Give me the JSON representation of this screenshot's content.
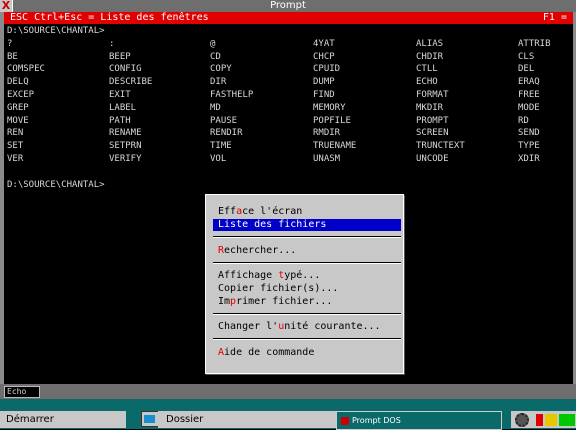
{
  "window": {
    "title": "Prompt",
    "close_glyph": "X"
  },
  "hotbar": {
    "left": "ESC   Ctrl+Esc = Liste des fenêtres",
    "right": "F1 ="
  },
  "terminal": {
    "prompt1": "D:\\SOURCE\\CHANTAL>",
    "commands": [
      [
        "?",
        ":",
        "@",
        "4YAT",
        "ALIAS",
        "ATTRIB"
      ],
      [
        "BE",
        "BEEP",
        "CD",
        "CHCP",
        "CHDIR",
        "CLS"
      ],
      [
        "COMSPEC",
        "CONFIG",
        "COPY",
        "CPUID",
        "CTLL",
        "DEL"
      ],
      [
        "DELQ",
        "DESCRIBE",
        "DIR",
        "DUMP",
        "ECHO",
        "ERAQ"
      ],
      [
        "EXCEP",
        "EXIT",
        "FASTHELP",
        "FIND",
        "FORMAT",
        "FREE"
      ],
      [
        "GREP",
        "LABEL",
        "MD",
        "MEMORY",
        "MKDIR",
        "MODE"
      ],
      [
        "MOVE",
        "PATH",
        "PAUSE",
        "POPFILE",
        "PROMPT",
        "RD"
      ],
      [
        "REN",
        "RENAME",
        "RENDIR",
        "RMDIR",
        "SCREEN",
        "SEND"
      ],
      [
        "SET",
        "SETPRN",
        "TIME",
        "TRUENAME",
        "TRUNCTEXT",
        "TYPE"
      ],
      [
        "VER",
        "VERIFY",
        "VOL",
        "UNASM",
        "UNCODE",
        "XDIR"
      ]
    ],
    "prompt2": "D:\\SOURCE\\CHANTAL>"
  },
  "context_menu": {
    "items": [
      {
        "pre": "Eff",
        "hk": "a",
        "post": "ce l'écran"
      },
      {
        "pre": "",
        "hk": "L",
        "post": "iste des fichiers"
      },
      {
        "pre": "",
        "hk": "R",
        "post": "echercher..."
      },
      {
        "pre": "Affichage ",
        "hk": "t",
        "post": "ypé..."
      },
      {
        "pre": "Copier fichier(s)",
        "hk": "",
        "post": "..."
      },
      {
        "pre": "Im",
        "hk": "p",
        "post": "rimer fichier..."
      },
      {
        "pre": "Changer l'",
        "hk": "u",
        "post": "nité courante..."
      },
      {
        "pre": "",
        "hk": "A",
        "post": "ide de commande"
      }
    ]
  },
  "status": {
    "label": "Echo"
  },
  "taskbar": {
    "start_label": "Démarrer",
    "folder_label": "Dossier",
    "task_label": "Prompt DOS",
    "colors": {
      "red": "#e00000",
      "yellow": "#e6c800",
      "green": "#00c800"
    }
  }
}
